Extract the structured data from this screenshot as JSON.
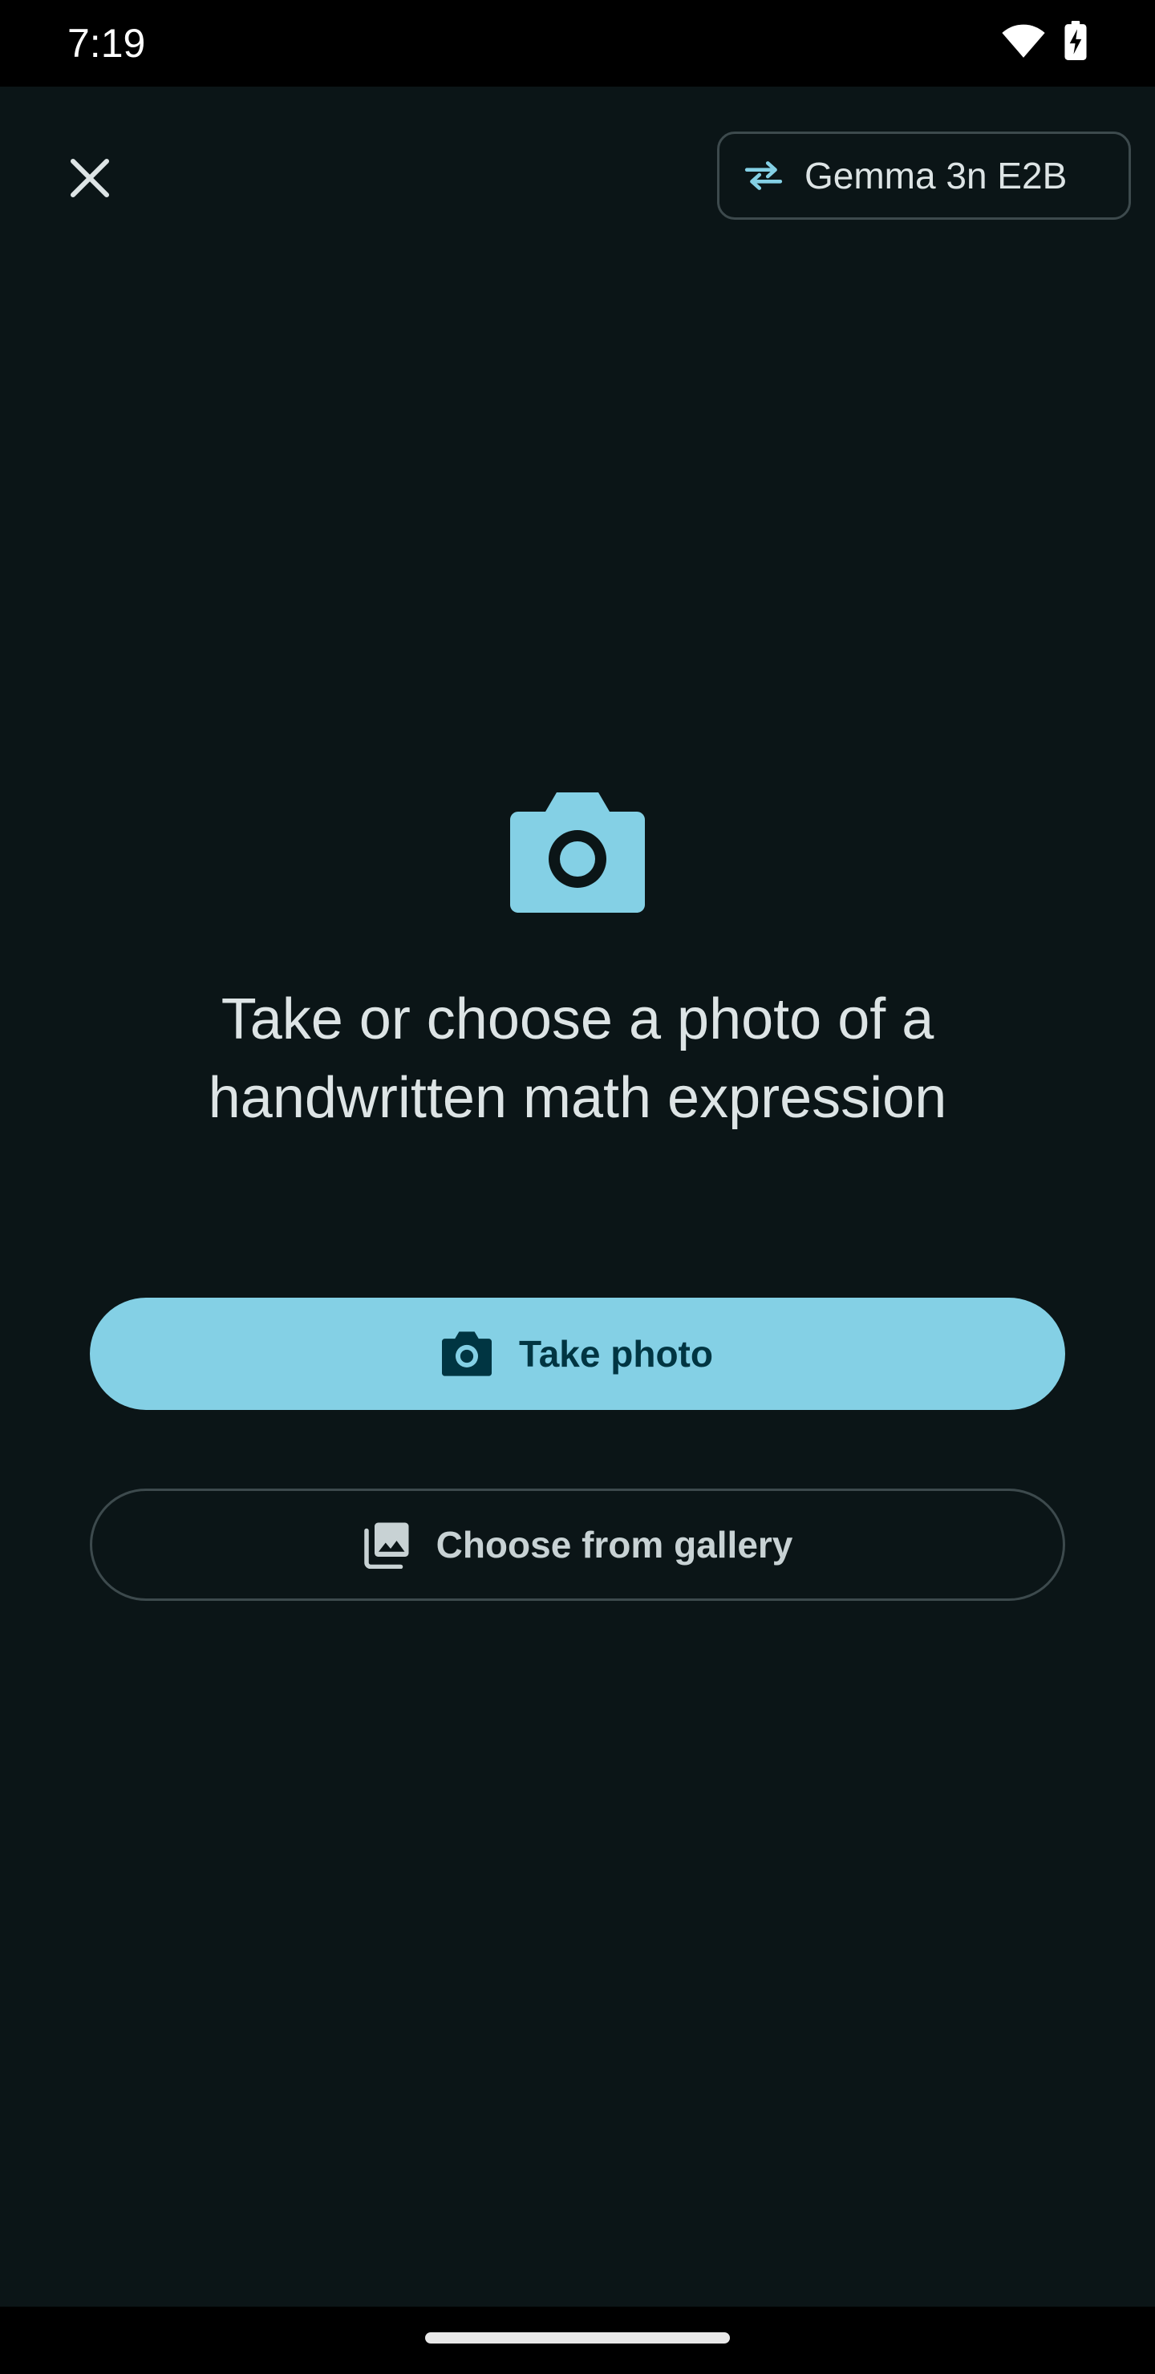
{
  "status_bar": {
    "time": "7:19",
    "icons": [
      "wifi-icon",
      "battery-charging-icon"
    ]
  },
  "header": {
    "close_icon": "close-icon",
    "model_selector": {
      "icon": "swap-arrows-icon",
      "label": "Gemma 3n E2B"
    }
  },
  "main": {
    "hero_icon": "camera-icon",
    "prompt": "Take or choose a photo of a handwritten math expression",
    "take_photo": {
      "icon": "camera-icon",
      "label": "Take photo"
    },
    "choose_gallery": {
      "icon": "photo-library-icon",
      "label": "Choose from gallery"
    }
  },
  "colors": {
    "background": "#0b1517",
    "accent": "#84d0e5",
    "on_accent": "#003542",
    "text": "#dde4e5",
    "outline": "#3d4a4d"
  }
}
